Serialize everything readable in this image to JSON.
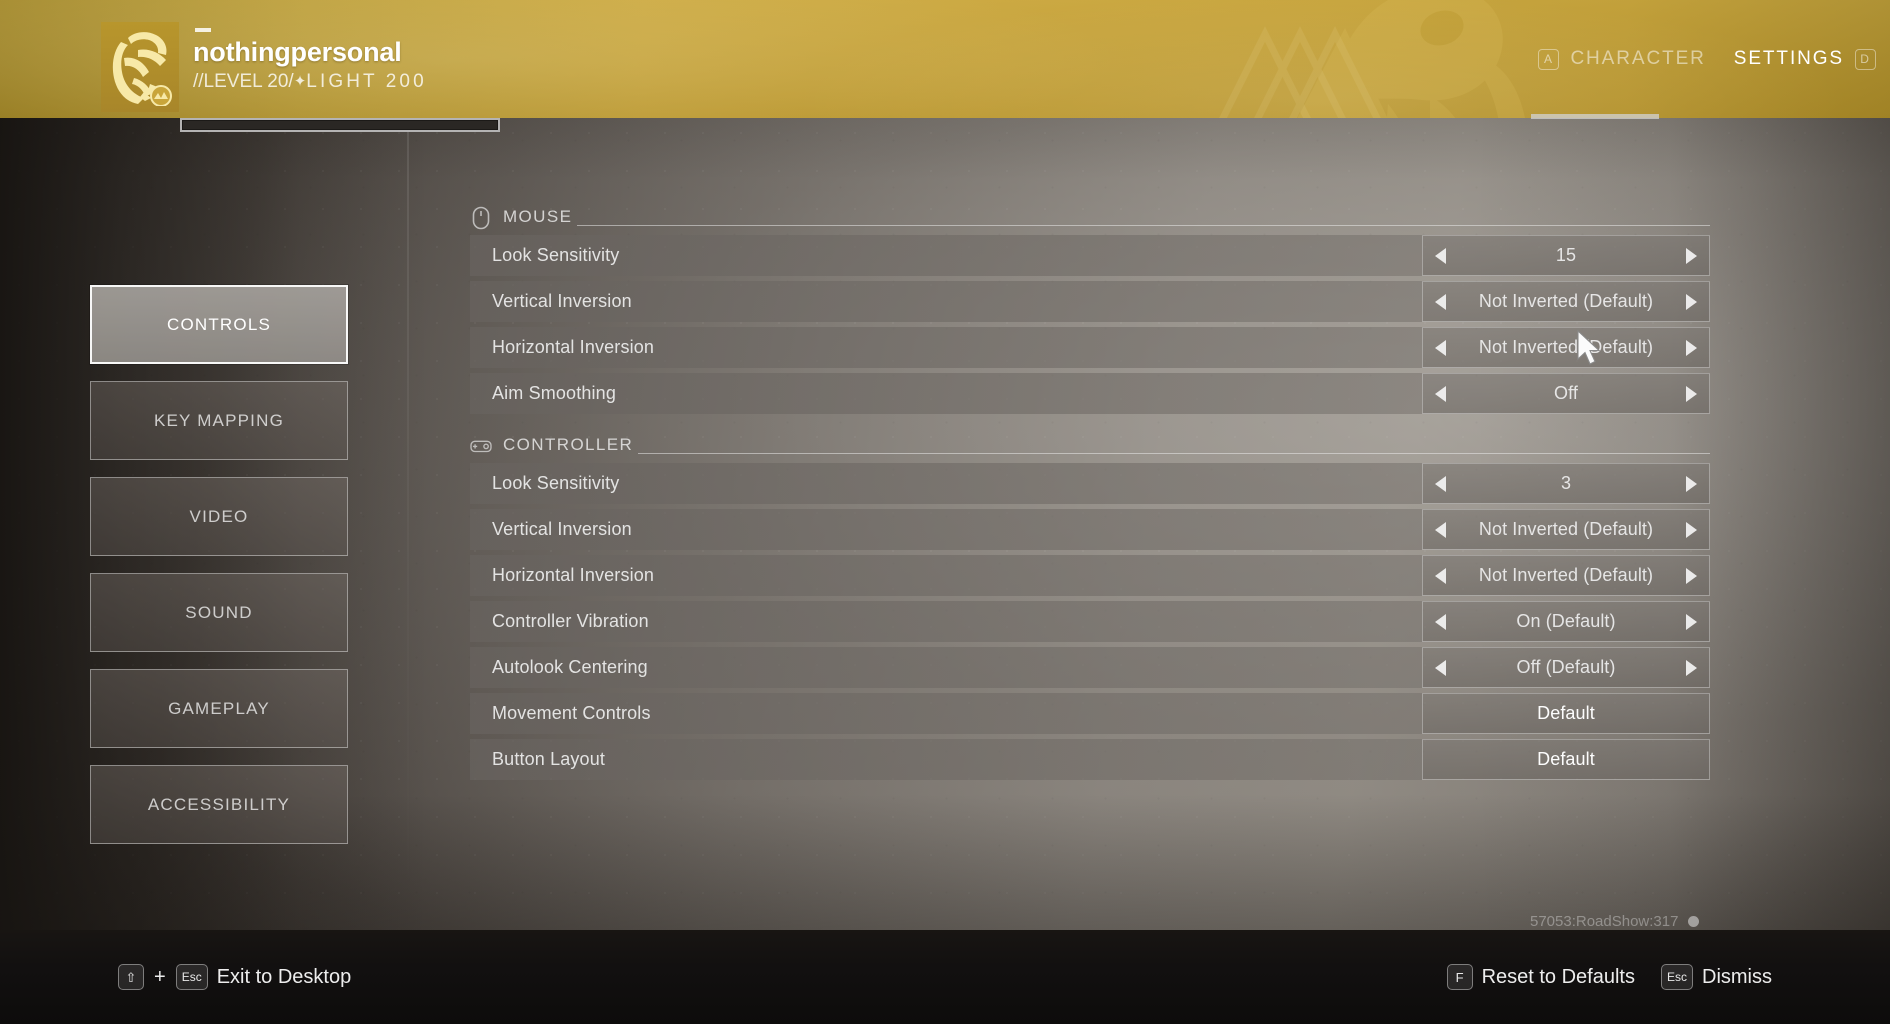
{
  "header": {
    "player_name": "nothingpersonal",
    "subtitle_prefix": "//LEVEL 20/",
    "subtitle_star": "✦",
    "subtitle_suffix": "LIGHT 200",
    "emblem_icon": "eagle-emblem-icon",
    "accent_color": "#c8a337",
    "xp_progress_percent": 0
  },
  "topnav": {
    "items": [
      {
        "key": "A",
        "label": "CHARACTER",
        "active": false
      },
      {
        "key": "D",
        "label": "SETTINGS",
        "active": true
      }
    ]
  },
  "sidebar": {
    "items": [
      {
        "label": "CONTROLS",
        "active": true
      },
      {
        "label": "KEY MAPPING",
        "active": false
      },
      {
        "label": "VIDEO",
        "active": false
      },
      {
        "label": "SOUND",
        "active": false
      },
      {
        "label": "GAMEPLAY",
        "active": false
      },
      {
        "label": "ACCESSIBILITY",
        "active": false
      }
    ]
  },
  "sections": [
    {
      "title": "MOUSE",
      "icon": "mouse-icon",
      "rows": [
        {
          "label": "Look Sensitivity",
          "value": "15",
          "type": "stepper"
        },
        {
          "label": "Vertical Inversion",
          "value": "Not Inverted (Default)",
          "type": "stepper"
        },
        {
          "label": "Horizontal Inversion",
          "value": "Not Inverted (Default)",
          "type": "stepper"
        },
        {
          "label": "Aim Smoothing",
          "value": "Off",
          "type": "stepper"
        }
      ]
    },
    {
      "title": "CONTROLLER",
      "icon": "gamepad-icon",
      "rows": [
        {
          "label": "Look Sensitivity",
          "value": "3",
          "type": "stepper"
        },
        {
          "label": "Vertical Inversion",
          "value": "Not Inverted (Default)",
          "type": "stepper"
        },
        {
          "label": "Horizontal Inversion",
          "value": "Not Inverted (Default)",
          "type": "stepper"
        },
        {
          "label": "Controller Vibration",
          "value": "On (Default)",
          "type": "stepper"
        },
        {
          "label": "Autolook Centering",
          "value": "Off (Default)",
          "type": "stepper"
        },
        {
          "label": "Movement Controls",
          "value": "Default",
          "type": "button"
        },
        {
          "label": "Button Layout",
          "value": "Default",
          "type": "button"
        }
      ]
    }
  ],
  "build_string": "57053:RoadShow:317",
  "footer": {
    "left": [
      {
        "keys": [
          "⇧",
          "Esc"
        ],
        "separator": "+",
        "label": "Exit to Desktop"
      }
    ],
    "right": [
      {
        "keys": [
          "F"
        ],
        "label": "Reset to Defaults"
      },
      {
        "keys": [
          "Esc"
        ],
        "label": "Dismiss"
      }
    ]
  }
}
